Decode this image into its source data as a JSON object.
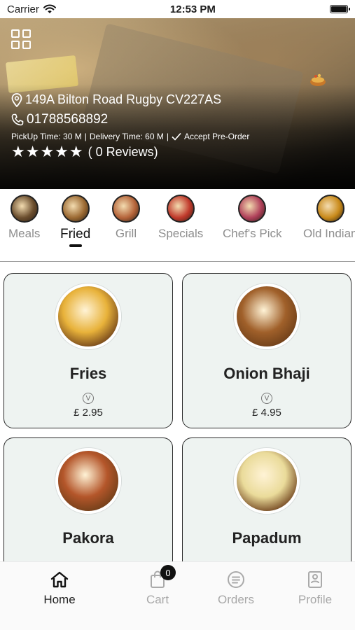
{
  "status_bar": {
    "carrier": "Carrier",
    "time": "12:53 PM",
    "battery_level_percent": 100
  },
  "hero": {
    "address": "149A Bilton Road Rugby CV227AS",
    "phone": "01788568892",
    "pickup_time": "PickUp Time: 30 M",
    "delivery_time": "Delivery Time: 60 M",
    "separator": "|",
    "preorder": "Accept Pre-Order",
    "stars": "★★★★★",
    "reviews": "( 0 Reviews)"
  },
  "categories": [
    {
      "label": "Meals",
      "color": "#6b4e2e",
      "active": false
    },
    {
      "label": "Fried",
      "color": "#9c6a33",
      "active": true
    },
    {
      "label": "Grill",
      "color": "#b5643a",
      "active": false
    },
    {
      "label": "Specials",
      "color": "#c0392b",
      "active": false
    },
    {
      "label": "Chef's Pick",
      "color": "#b0405a",
      "active": false
    },
    {
      "label": "Old Indian",
      "color": "#c98a1a",
      "active": false
    }
  ],
  "products": [
    {
      "name": "Fries",
      "price": "£ 2.95",
      "veg_symbol": "V",
      "color": "#e8b23a"
    },
    {
      "name": "Onion Bhaji",
      "price": "£ 4.95",
      "veg_symbol": "V",
      "color": "#a0602a"
    },
    {
      "name": "Pakora",
      "price": "",
      "veg_symbol": "",
      "color": "#b4562a"
    },
    {
      "name": "Papadum",
      "price": "",
      "veg_symbol": "",
      "color": "#eadb9a"
    }
  ],
  "bottom_nav": {
    "home": "Home",
    "cart": "Cart",
    "cart_count": "0",
    "orders": "Orders",
    "profile": "Profile"
  },
  "icons": {
    "menu": "grid-icon",
    "location": "map-pin-icon",
    "phone": "phone-icon",
    "check": "check-icon",
    "home": "home-icon",
    "cart": "shopping-bag-icon",
    "orders": "orders-icon",
    "profile": "profile-icon"
  }
}
